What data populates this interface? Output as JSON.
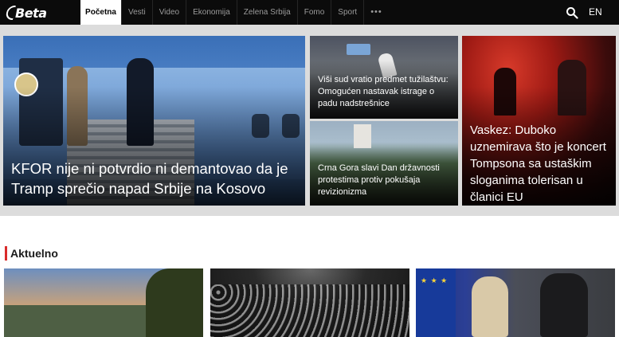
{
  "nav": {
    "logo_text": "Beta",
    "items": [
      {
        "label": "Početna",
        "active": true
      },
      {
        "label": "Vesti"
      },
      {
        "label": "Video"
      },
      {
        "label": "Ekonomija"
      },
      {
        "label": "Zelena Srbija"
      },
      {
        "label": "Fomo"
      },
      {
        "label": "Sport"
      }
    ],
    "more_label": "•••",
    "search_icon": "search-icon",
    "language_label": "EN"
  },
  "hero": {
    "main_title": "KFOR nije ni potvrdio ni demantovao da je Tramp sprečio napad Srbije na Kosovo",
    "top_middle_title": "Viši sud vratio predmet tužilaštvu: Omogućen nastavak istrage o padu nadstrešnice",
    "bottom_middle_title": "Crna Gora slavi Dan državnosti protestima protiv pokušaja revizionizma",
    "right_title": "Vaskez: Duboko uznemirava što je koncert Tompsona sa ustaškim sloganima tolerisan u članici EU"
  },
  "section": {
    "title": "Aktuelno",
    "accent_color": "#d92b2b"
  },
  "colors": {
    "nav_bg": "#0b0b0b",
    "hero_bg": "#dcdcdc"
  }
}
